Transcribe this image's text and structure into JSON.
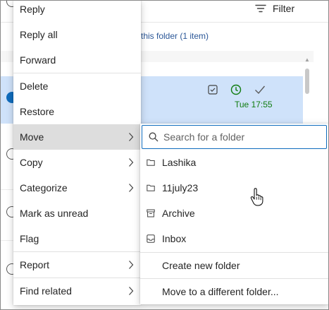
{
  "header": {
    "filter_label": "Filter",
    "folder_note": "this folder (1 item)"
  },
  "message_row": {
    "time": "Tue 17:55"
  },
  "context_menu": {
    "items": [
      {
        "label": "Reply"
      },
      {
        "label": "Reply all"
      },
      {
        "label": "Forward"
      },
      {
        "label": "Delete"
      },
      {
        "label": "Restore"
      },
      {
        "label": "Move",
        "has_submenu": true,
        "active": true
      },
      {
        "label": "Copy",
        "has_submenu": true
      },
      {
        "label": "Categorize",
        "has_submenu": true
      },
      {
        "label": "Mark as unread"
      },
      {
        "label": "Flag"
      },
      {
        "label": "Report",
        "has_submenu": true
      },
      {
        "label": "Find related",
        "has_submenu": true
      }
    ]
  },
  "move_submenu": {
    "search_placeholder": "Search for a folder",
    "folders": [
      {
        "label": "Lashika",
        "icon": "folder-icon"
      },
      {
        "label": "11july23",
        "icon": "folder-icon"
      },
      {
        "label": "Archive",
        "icon": "archive-icon"
      },
      {
        "label": "Inbox",
        "icon": "inbox-icon"
      }
    ],
    "actions": [
      {
        "label": "Create new folder"
      },
      {
        "label": "Move to a different folder..."
      }
    ]
  },
  "colors": {
    "accent": "#0f6cbd",
    "selected_row": "#cfe2fa",
    "active_menu_item": "#dddddd",
    "time_green": "#107c10"
  }
}
